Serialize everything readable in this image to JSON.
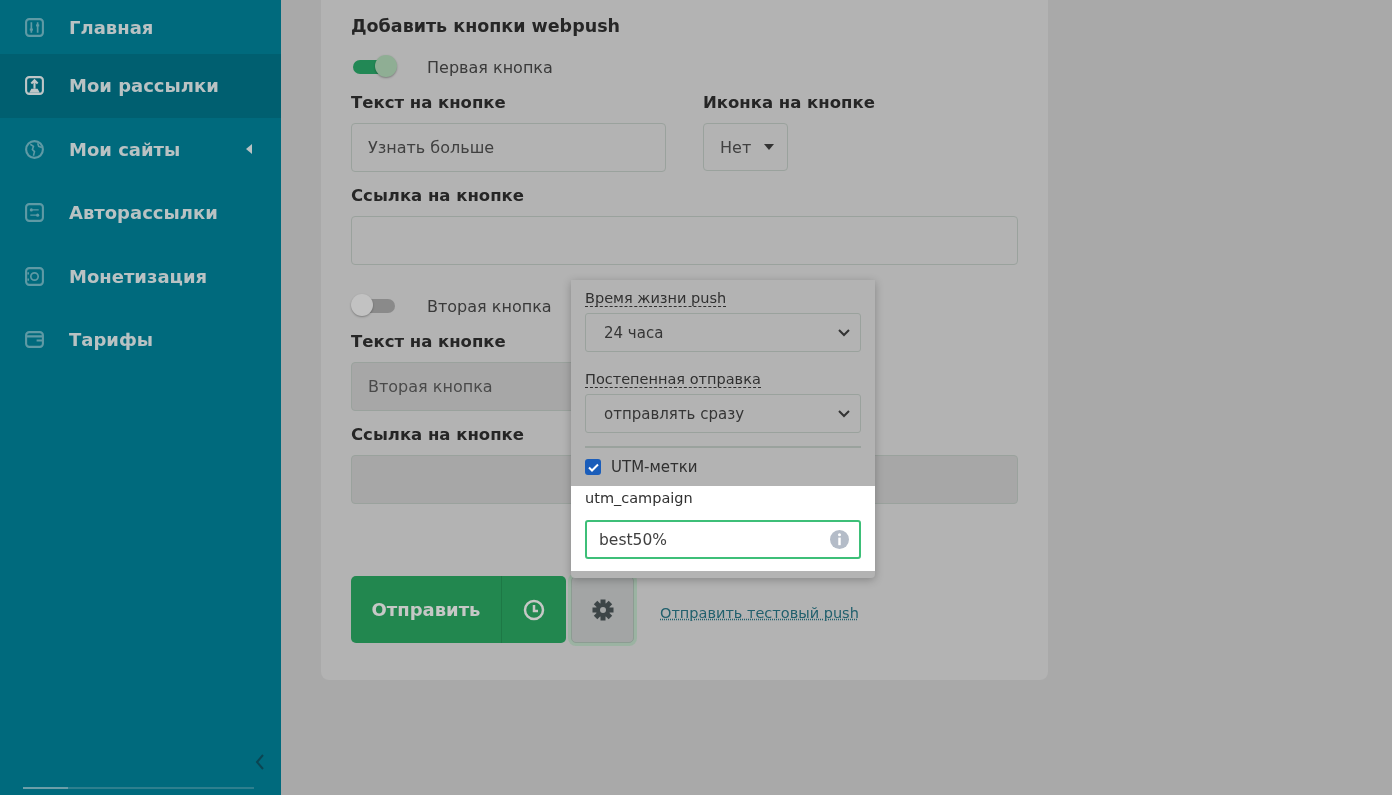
{
  "sidebar": {
    "items": [
      {
        "label": "Главная",
        "selected": false,
        "expandable": false
      },
      {
        "label": "Мои рассылки",
        "selected": true,
        "expandable": false
      },
      {
        "label": "Мои сайты",
        "selected": false,
        "expandable": true
      },
      {
        "label": "Авторассылки",
        "selected": false,
        "expandable": false
      },
      {
        "label": "Монетизация",
        "selected": false,
        "expandable": false
      },
      {
        "label": "Тарифы",
        "selected": false,
        "expandable": false
      }
    ]
  },
  "form": {
    "title": "Добавить кнопки webpush",
    "buttons": [
      {
        "toggle_label": "Первая кнопка",
        "on": true,
        "text_label": "Текст на кнопке",
        "text_value": "Узнать больше",
        "icon_label": "Иконка на кнопке",
        "icon_value": "Нет",
        "link_label": "Ссылка на кнопке",
        "disabled": false
      },
      {
        "toggle_label": "Вторая кнопка",
        "on": false,
        "text_label": "Текст на кнопке",
        "placeholder": "Вторая кнопка",
        "link_label": "Ссылка на кнопке",
        "disabled": true
      }
    ],
    "send_button": "Отправить",
    "test_link": "Отправить тестовый push"
  },
  "settings_popover": {
    "lifetime_label": "Время жизни push",
    "lifetime_value": "24 часа",
    "gradual_label": "Постепенная отправка",
    "gradual_value": "отправлять сразу",
    "utm_label": "UTM-метки",
    "utm_checked": true,
    "utm_campaign_label": "utm_campaign",
    "utm_campaign_value": "best50%"
  }
}
